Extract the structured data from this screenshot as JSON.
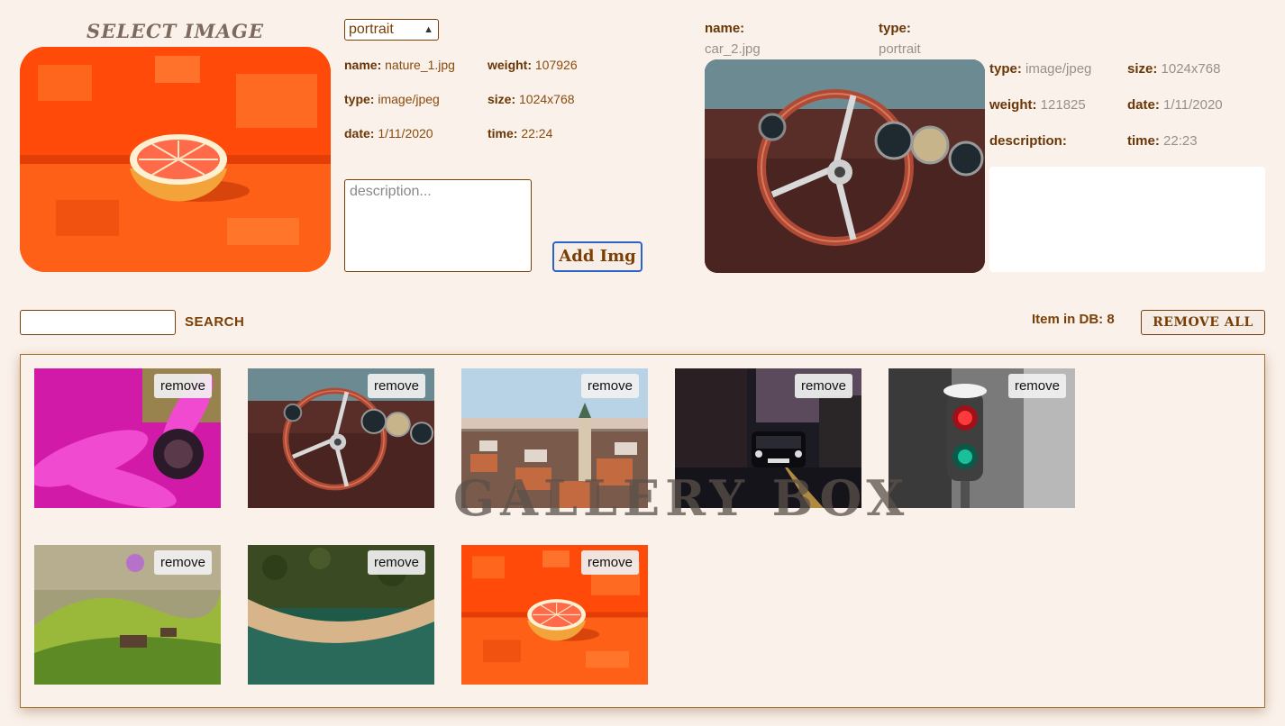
{
  "upload": {
    "title": "SELECT IMAGE",
    "type_selected": "portrait",
    "fields": {
      "name_label": "name:",
      "name_value": "nature_1.jpg",
      "weight_label": "weight:",
      "weight_value": "107926",
      "type_label": "type:",
      "type_value": "image/jpeg",
      "size_label": "size:",
      "size_value": "1024x768",
      "date_label": "date:",
      "date_value": "1/11/2020",
      "time_label": "time:",
      "time_value": "22:24"
    },
    "description_placeholder": "description...",
    "add_button": "Add Img"
  },
  "detail": {
    "name_label": "name:",
    "name_value": "car_2.jpg",
    "type_label": "type:",
    "type_value": "portrait",
    "mime_label": "type:",
    "mime_value": "image/jpeg",
    "size_label": "size:",
    "size_value": "1024x768",
    "weight_label": "weight:",
    "weight_value": "121825",
    "date_label": "date:",
    "date_value": "1/11/2020",
    "description_label": "description:",
    "time_label": "time:",
    "time_value": "22:23"
  },
  "toolbar": {
    "search_label": "SEARCH",
    "db_count": "Item in DB: 8",
    "remove_all": "REMOVE ALL"
  },
  "gallery": {
    "watermark": "GALLERY BOX",
    "remove_label": "remove",
    "items": [
      {
        "subject": "flower"
      },
      {
        "subject": "car-interior"
      },
      {
        "subject": "city"
      },
      {
        "subject": "taxi-street"
      },
      {
        "subject": "traffic-light"
      },
      {
        "subject": "green-hills"
      },
      {
        "subject": "lake-shore"
      },
      {
        "subject": "grapefruit"
      }
    ]
  }
}
